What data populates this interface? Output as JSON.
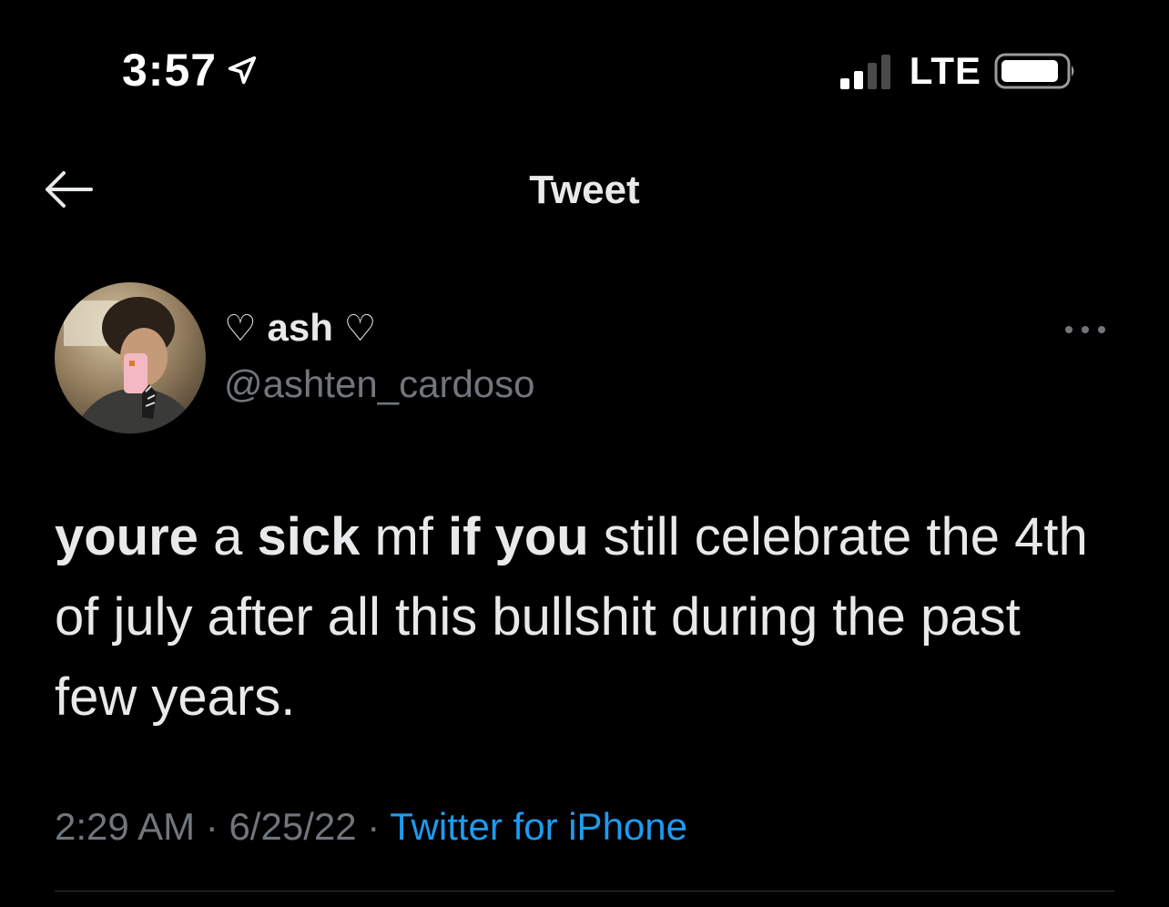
{
  "status_bar": {
    "time": "3:57",
    "network": "LTE",
    "location_icon": "location-arrow-icon",
    "signal_icon": "signal-bars-icon",
    "signal_bars_filled": 2,
    "signal_bars_total": 4,
    "battery_icon": "battery-icon"
  },
  "nav": {
    "back_icon": "arrow-left-icon",
    "title": "Tweet"
  },
  "tweet": {
    "author": {
      "heart_left": "♡",
      "name": "ash",
      "heart_right": "♡",
      "handle": "@ashten_cardoso"
    },
    "more_icon": "ellipsis-icon",
    "text_segments": [
      {
        "text": "youre",
        "bold": true
      },
      {
        "text": " a ",
        "bold": false
      },
      {
        "text": "sick",
        "bold": true
      },
      {
        "text": " mf ",
        "bold": false
      },
      {
        "text": "if you",
        "bold": true
      },
      {
        "text": " still celebrate the 4th of july after all this bullshit during the past few years.",
        "bold": false
      }
    ],
    "time": "2:29 AM",
    "separator": "·",
    "date": "6/25/22",
    "source": "Twitter for iPhone"
  },
  "colors": {
    "background": "#000000",
    "text_primary": "#e7e9ea",
    "text_secondary": "#71767b",
    "link": "#1d9bf0",
    "divider": "#2f3336"
  }
}
